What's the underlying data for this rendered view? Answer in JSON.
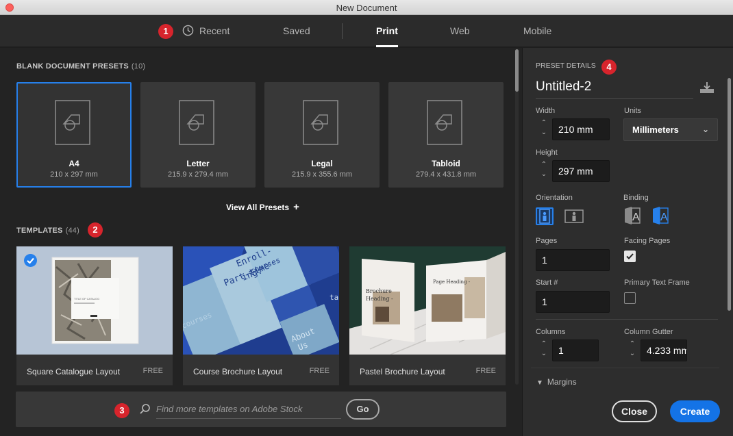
{
  "window": {
    "title": "New Document"
  },
  "tabs": [
    {
      "label": "Recent",
      "icon": "clock-icon"
    },
    {
      "label": "Saved"
    },
    {
      "label": "Print",
      "active": true
    },
    {
      "label": "Web"
    },
    {
      "label": "Mobile"
    }
  ],
  "badges": [
    "1",
    "2",
    "3",
    "4"
  ],
  "presets": {
    "heading": "BLANK DOCUMENT PRESETS",
    "count": "(10)",
    "items": [
      {
        "name": "A4",
        "size": "210 x 297 mm",
        "selected": true
      },
      {
        "name": "Letter",
        "size": "215.9 x 279.4 mm"
      },
      {
        "name": "Legal",
        "size": "215.9 x 355.6 mm"
      },
      {
        "name": "Tabloid",
        "size": "279.4 x 431.8 mm"
      }
    ],
    "view_all": "View All Presets"
  },
  "templates": {
    "heading": "TEMPLATES",
    "count": "(44)",
    "items": [
      {
        "name": "Square Catalogue Layout",
        "price": "FREE",
        "selected": true
      },
      {
        "name": "Course Brochure Layout",
        "price": "FREE"
      },
      {
        "name": "Pastel Brochure Layout",
        "price": "FREE"
      }
    ],
    "thumb_text": {
      "t1_title": "TITLE OF CATALOG",
      "t2_a": "Enroll-",
      "t2_b": "ing:",
      "t2_c": "Part-time",
      "t2_d": "courses",
      "t2_e": "About",
      "t2_f": "Us",
      "t2_g": "ta",
      "t3_a": "Brochure",
      "t3_b": "Heading -",
      "t3_c": "Page Heading -"
    }
  },
  "stock": {
    "placeholder": "Find more templates on Adobe Stock",
    "go_label": "Go"
  },
  "details": {
    "heading": "PRESET DETAILS",
    "doc_name": "Untitled-2",
    "width_label": "Width",
    "width_value": "210 mm",
    "units_label": "Units",
    "units_value": "Millimeters",
    "height_label": "Height",
    "height_value": "297 mm",
    "orientation_label": "Orientation",
    "binding_label": "Binding",
    "binding_left_glyph": "A",
    "binding_right_glyph": "A",
    "pages_label": "Pages",
    "pages_value": "1",
    "facing_label": "Facing Pages",
    "facing_checked": true,
    "start_label": "Start #",
    "start_value": "1",
    "primary_label": "Primary Text Frame",
    "primary_checked": false,
    "columns_label": "Columns",
    "columns_value": "1",
    "gutter_label": "Column Gutter",
    "gutter_value": "4.233 mm",
    "margins_label": "Margins"
  },
  "actions": {
    "close": "Close",
    "create": "Create"
  },
  "colors": {
    "accent": "#2680eb",
    "badge": "#d7242c",
    "create": "#1473e6"
  }
}
